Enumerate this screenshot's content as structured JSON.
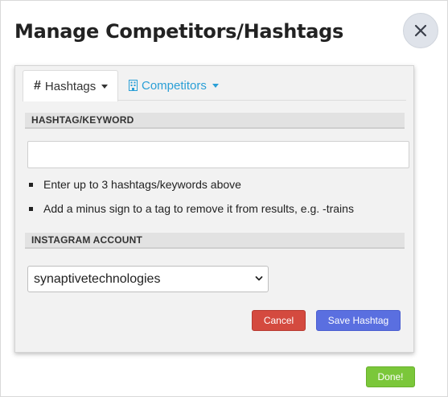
{
  "modal": {
    "title": "Manage Competitors/Hashtags"
  },
  "tabs": [
    {
      "label": "Hashtags",
      "icon": "hashtag-icon",
      "active": true
    },
    {
      "label": "Competitors",
      "icon": "building-icon",
      "active": false
    }
  ],
  "hashtag_section": {
    "header": "HASHTAG/KEYWORD",
    "input_value": "",
    "hints": [
      "Enter up to 3 hashtags/keywords above",
      "Add a minus sign to a tag to remove it from results, e.g. -trains"
    ]
  },
  "account_section": {
    "header": "INSTAGRAM ACCOUNT",
    "selected": "synaptivetechnologies"
  },
  "actions": {
    "cancel": "Cancel",
    "save": "Save Hashtag",
    "done": "Done!"
  },
  "colors": {
    "competitors_tab": "#2a9fd6",
    "cancel": "#d44a3f",
    "save": "#5a6fe0",
    "done": "#7bc73a"
  }
}
